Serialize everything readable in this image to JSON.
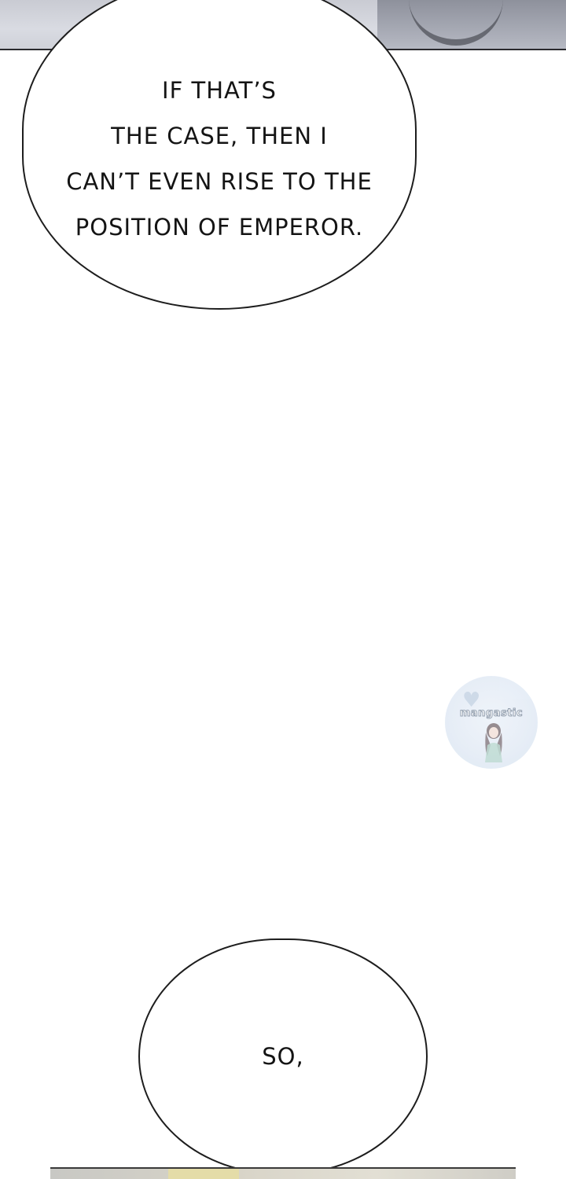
{
  "panels": {
    "top_bubble": {
      "lines": [
        "IF THAT’S",
        "THE CASE, THEN I",
        "CAN’T EVEN RISE TO THE",
        "POSITION OF EMPEROR."
      ]
    },
    "bottom_bubble": {
      "lines": [
        "SO,"
      ]
    }
  },
  "watermark": {
    "text": "mangastic",
    "icon": "heart-icon"
  },
  "colors": {
    "ink": "#141414",
    "background": "#ffffff",
    "watermark_tint": "#dbe5f2"
  }
}
